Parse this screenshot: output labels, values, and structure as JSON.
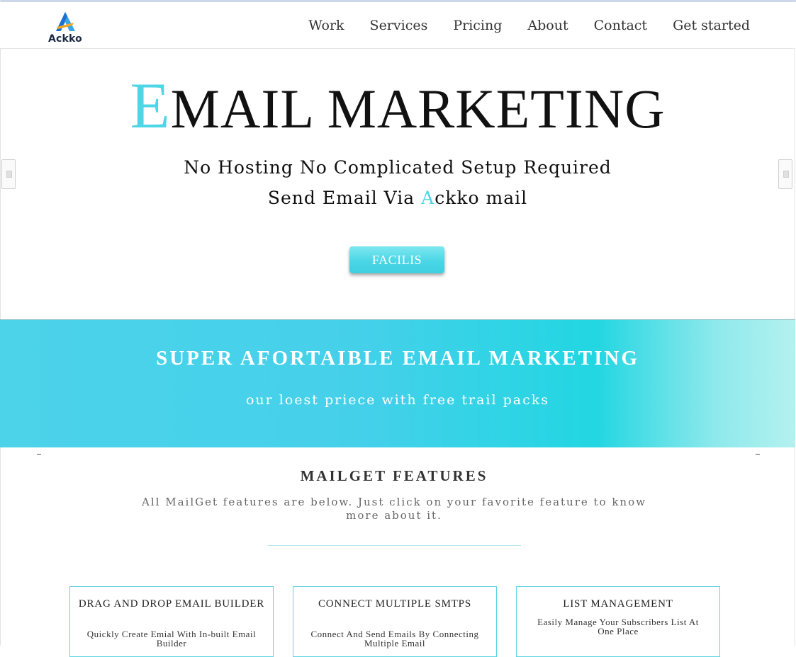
{
  "brand": {
    "logo_text": "Ackko",
    "accent_color": "#4dd6e6"
  },
  "nav": {
    "items": [
      {
        "label": "Work"
      },
      {
        "label": "Services"
      },
      {
        "label": "Pricing"
      },
      {
        "label": "About"
      },
      {
        "label": "Contact"
      },
      {
        "label": "Get started"
      }
    ]
  },
  "hero": {
    "title_initial": "E",
    "title_rest": "MAIL MARKETING",
    "line1": "No Hosting No Complicated Setup Required",
    "line2_prefix": "Send Email Via ",
    "line2_accent": "A",
    "line2_suffix": "ckko mail",
    "cta_label": "FACILIS"
  },
  "banner": {
    "title": "SUPER AFORTAIBLE EMAIL MARKETING",
    "subtitle": "our loest priece with free trail packs"
  },
  "features": {
    "title": "MAILGET FEATURES",
    "description": "All MailGet features are below. Just click on your favorite feature to know more about it.",
    "cards": [
      {
        "title": "DRAG AND DROP EMAIL BUILDER",
        "text": "Quickly Create Emial With In-built Email Builder"
      },
      {
        "title": "CONNECT MULTIPLE SMTPS",
        "text": "Connect And Send Emails By Connecting Multiple Email"
      },
      {
        "title": "LIST MANAGEMENT",
        "text": "Easily Manage Your Subscribers List At One Place"
      }
    ]
  }
}
